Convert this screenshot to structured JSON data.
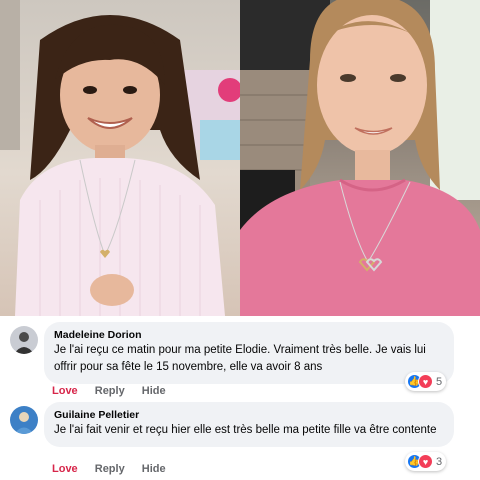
{
  "photos": {
    "left": {
      "subject": "girl-with-necklace-left"
    },
    "right": {
      "subject": "girl-with-necklace-right"
    }
  },
  "comments": [
    {
      "author": "Madeleine Dorion",
      "text": "Je l'ai reçu ce matin pour ma petite Elodie. Vraiment très belle. Je vais lui offrir pour sa fête le 15 novembre, elle va avoir 8 ans",
      "actions": {
        "love": "Love",
        "reply": "Reply",
        "hide": "Hide"
      },
      "reaction_count": "5",
      "reaction_icons": [
        "like-icon",
        "love-icon"
      ]
    },
    {
      "author": "Guilaine Pelletier",
      "text": "Je l'ai fait venir et reçu hier elle est très belle ma petite fille va être contente",
      "actions": {
        "love": "Love",
        "reply": "Reply",
        "hide": "Hide"
      },
      "reaction_count": "3",
      "reaction_icons": [
        "like-icon",
        "love-icon"
      ]
    }
  ],
  "colors": {
    "love_action": "#d7264a",
    "like_reaction": "#1877f2",
    "love_reaction": "#f33e58",
    "bubble": "#f0f2f5"
  }
}
